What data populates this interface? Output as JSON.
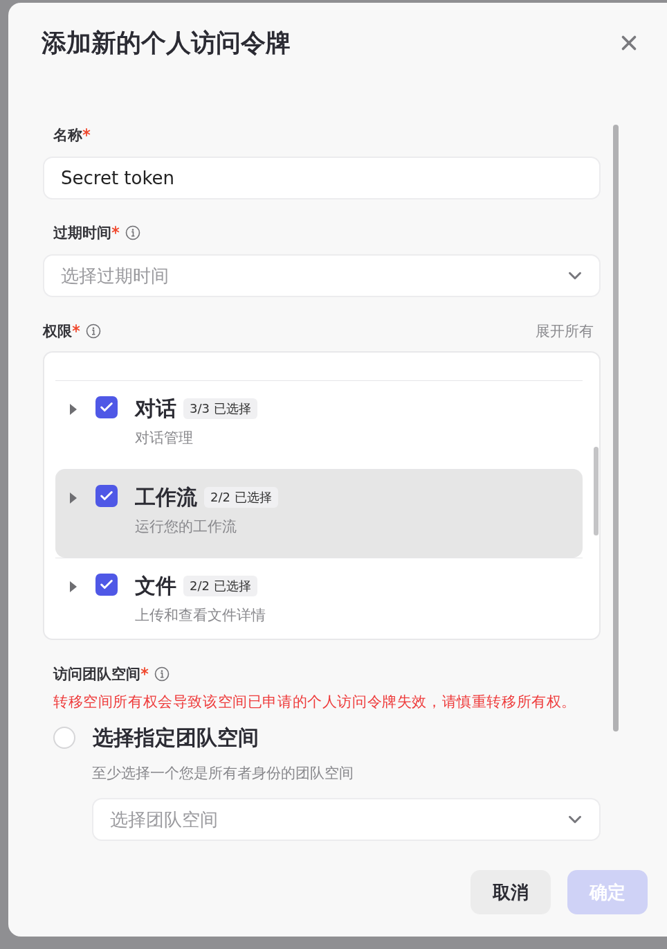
{
  "dialog": {
    "title": "添加新的个人访问令牌"
  },
  "fields": [
    {
      "kind": "text",
      "label": "名称",
      "required": true,
      "value": "Secret token"
    },
    {
      "kind": "select",
      "label": "过期时间",
      "required": true,
      "info": true,
      "placeholder": "选择过期时间"
    }
  ],
  "permissions": {
    "label": "权限",
    "required": true,
    "info": true,
    "expand_all": "展开所有",
    "items": [
      {
        "name": "对话",
        "count": "3/3 已选择",
        "description": "对话管理",
        "checked": true,
        "highlighted": false
      },
      {
        "name": "工作流",
        "count": "2/2 已选择",
        "description": "运行您的工作流",
        "checked": true,
        "highlighted": true
      },
      {
        "name": "文件",
        "count": "2/2 已选择",
        "description": "上传和查看文件详情",
        "checked": true,
        "highlighted": false
      }
    ]
  },
  "team_space": {
    "label": "访问团队空间",
    "required": true,
    "info": true,
    "warning": "转移空间所有权会导致该空间已申请的个人访问令牌失效，请慎重转移所有权。",
    "options": [
      {
        "label": "选择指定团队空间",
        "hint": "至少选择一个您是所有者身份的团队空间",
        "selected": false,
        "select_placeholder": "选择团队空间"
      }
    ]
  },
  "buttons": [
    {
      "kind": "secondary",
      "label": "取消",
      "disabled": false
    },
    {
      "kind": "primary",
      "label": "确定",
      "disabled": true
    }
  ]
}
